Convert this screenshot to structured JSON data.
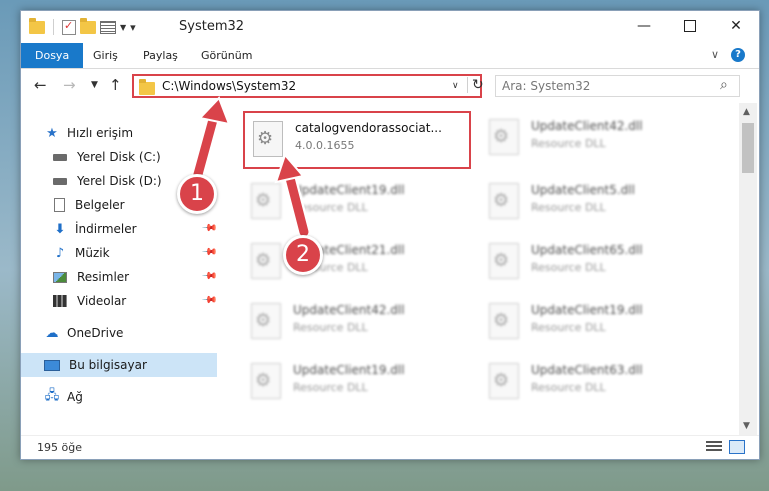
{
  "window": {
    "title": "System32"
  },
  "ribbon": {
    "tabs": [
      "Dosya",
      "Giriş",
      "Paylaş",
      "Görünüm"
    ]
  },
  "navbar": {
    "address": "C:\\Windows\\System32",
    "search_placeholder": "Ara: System32"
  },
  "sidebar": {
    "items": [
      {
        "label": "Hızlı erişim"
      },
      {
        "label": "Yerel Disk (C:)"
      },
      {
        "label": "Yerel Disk (D:)"
      },
      {
        "label": "Belgeler"
      },
      {
        "label": "İndirmeler"
      },
      {
        "label": "Müzik"
      },
      {
        "label": "Resimler"
      },
      {
        "label": "Videolar"
      },
      {
        "label": "OneDrive"
      },
      {
        "label": "Bu bilgisayar"
      },
      {
        "label": "Ağ"
      }
    ]
  },
  "files": [
    {
      "name": "catalogvendorassociat...",
      "desc": "4.0.0.1655"
    },
    {
      "name": "UpdateClient42.dll",
      "desc": "Resource DLL"
    },
    {
      "name": "UpdateClient19.dll",
      "desc": "Resource DLL"
    },
    {
      "name": "UpdateClient5.dll",
      "desc": "Resource DLL"
    },
    {
      "name": "UpdateClient21.dll",
      "desc": "Resource DLL"
    },
    {
      "name": "UpdateClient65.dll",
      "desc": "Resource DLL"
    },
    {
      "name": "UpdateClient42.dll",
      "desc": "Resource DLL"
    },
    {
      "name": "UpdateClient19.dll",
      "desc": "Resource DLL"
    },
    {
      "name": "UpdateClient19.dll",
      "desc": "Resource DLL"
    },
    {
      "name": "UpdateClient63.dll",
      "desc": "Resource DLL"
    }
  ],
  "status": {
    "count": "195 öğe"
  },
  "annotations": {
    "step1": "1",
    "step2": "2",
    "color": "#d9434a"
  }
}
